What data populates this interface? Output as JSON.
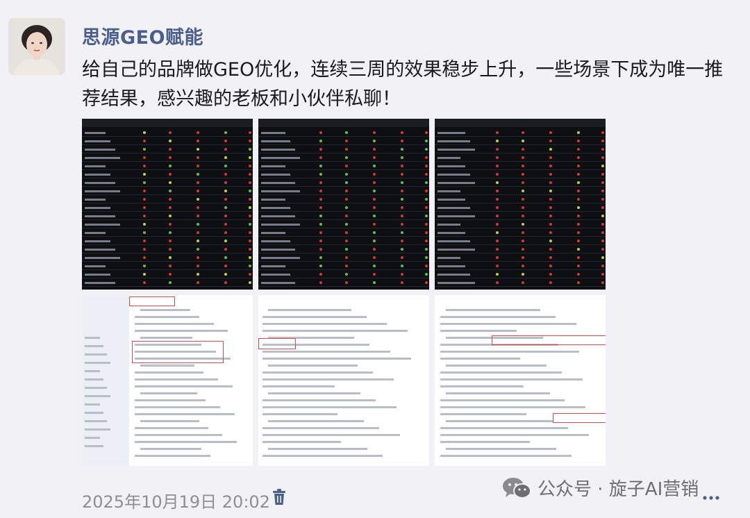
{
  "author": {
    "name": "思源GEO赋能",
    "avatar_icon": "portrait-avatar"
  },
  "post": {
    "text": "给自己的品牌做GEO优化，连续三周的效果稳步上升，一些场景下成为唯一推荐结果，感兴趣的老板和小伙伴私聊！"
  },
  "images": [
    {
      "kind": "dark-table-screenshot"
    },
    {
      "kind": "dark-table-screenshot"
    },
    {
      "kind": "dark-table-screenshot"
    },
    {
      "kind": "ai-chat-screenshot"
    },
    {
      "kind": "ai-chat-screenshot"
    },
    {
      "kind": "ai-chat-screenshot"
    }
  ],
  "footer": {
    "timestamp": "2025年10月19日 20:02",
    "delete_icon": "trash-icon",
    "watermark": "公众号 · 旋子AI营销",
    "watermark_icon": "wechat-icon"
  },
  "colors": {
    "name": "#4a5f8e",
    "dot_yellow": "#c8d12b",
    "dot_red": "#d8362e",
    "dot_green": "#62c33a",
    "highlight": "#d94a4a"
  }
}
